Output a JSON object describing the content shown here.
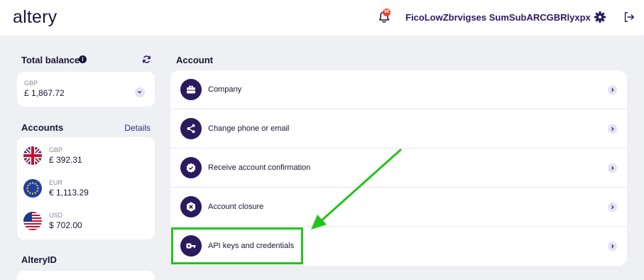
{
  "header": {
    "logo": "altery",
    "notification_badge": "99",
    "username": "FicoLowZbrvigses SumSubARCGBRlyxpx"
  },
  "balance": {
    "title": "Total balance",
    "currency": "GBP",
    "amount": "£ 1,867.72"
  },
  "accounts": {
    "title": "Accounts",
    "details_label": "Details",
    "items": [
      {
        "currency": "GBP",
        "amount": "£ 392.31",
        "flag": "uk-flag-icon"
      },
      {
        "currency": "EUR",
        "amount": "€ 1,113.29",
        "flag": "eu-flag-icon"
      },
      {
        "currency": "USD",
        "amount": "$ 702.00",
        "flag": "us-flag-icon"
      }
    ]
  },
  "alteryid": {
    "title": "AlteryID"
  },
  "account_section": {
    "title": "Account",
    "items": [
      {
        "label": "Company",
        "icon": "briefcase-icon"
      },
      {
        "label": "Change phone or email",
        "icon": "share-icon"
      },
      {
        "label": "Receive account confirmation",
        "icon": "verified-badge-icon"
      },
      {
        "label": "Account closure",
        "icon": "close-hexagon-icon"
      },
      {
        "label": "API keys and credentials",
        "icon": "key-icon"
      }
    ]
  },
  "colors": {
    "brand": "#2a1a5e",
    "highlight": "#22c41c",
    "background": "#eef0f4"
  }
}
